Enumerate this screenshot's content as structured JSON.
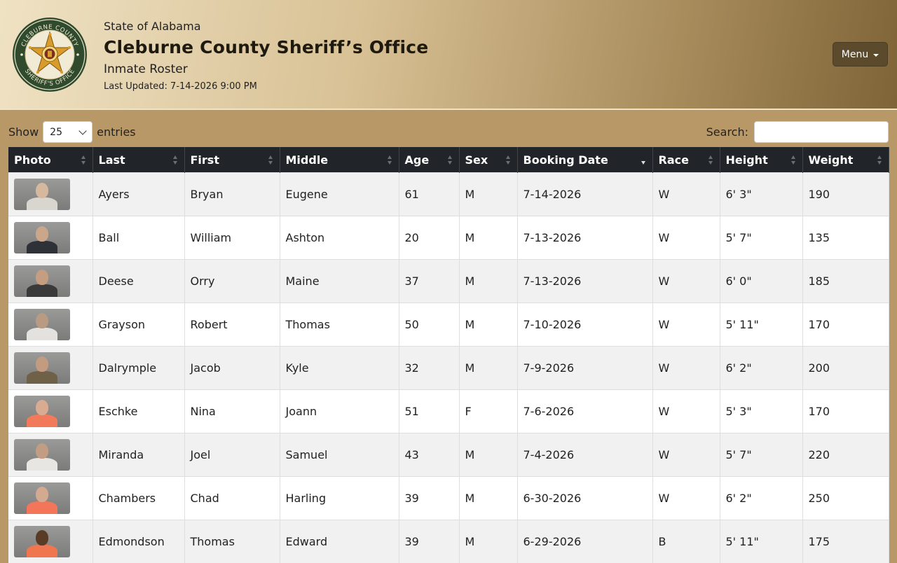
{
  "header": {
    "state": "State of Alabama",
    "office": "Cleburne County Sheriff’s Office",
    "subtitle": "Inmate Roster",
    "last_updated": "Last Updated: 7-14-2026 9:00 PM",
    "seal_text_top": "CLEBURNE COUNTY",
    "seal_text_bottom": "SHERIFF'S OFFICE",
    "menu_label": "Menu"
  },
  "controls": {
    "show_label": "Show",
    "entries_value": "25",
    "entries_label": "entries",
    "search_label": "Search:",
    "search_value": ""
  },
  "table": {
    "columns": [
      "Photo",
      "Last",
      "First",
      "Middle",
      "Age",
      "Sex",
      "Booking Date",
      "Race",
      "Height",
      "Weight"
    ],
    "sorted_column": "Booking Date",
    "rows": [
      {
        "last": "Ayers",
        "first": "Bryan",
        "middle": "Eugene",
        "age": "61",
        "sex": "M",
        "booking": "7-14-2026",
        "race": "W",
        "height": "6' 3\"",
        "weight": "190",
        "shirt": "#d8d6cf",
        "skin": "#d5b89e"
      },
      {
        "last": "Ball",
        "first": "William",
        "middle": "Ashton",
        "age": "20",
        "sex": "M",
        "booking": "7-13-2026",
        "race": "W",
        "height": "5' 7\"",
        "weight": "135",
        "shirt": "#2f3138",
        "skin": "#caa78a"
      },
      {
        "last": "Deese",
        "first": "Orry",
        "middle": "Maine",
        "age": "37",
        "sex": "M",
        "booking": "7-13-2026",
        "race": "W",
        "height": "6' 0\"",
        "weight": "185",
        "shirt": "#3a3a3a",
        "skin": "#c59d80"
      },
      {
        "last": "Grayson",
        "first": "Robert",
        "middle": "Thomas",
        "age": "50",
        "sex": "M",
        "booking": "7-10-2026",
        "race": "W",
        "height": "5' 11\"",
        "weight": "170",
        "shirt": "#e4e2de",
        "skin": "#b99a83"
      },
      {
        "last": "Dalrymple",
        "first": "Jacob",
        "middle": "Kyle",
        "age": "32",
        "sex": "M",
        "booking": "7-9-2026",
        "race": "W",
        "height": "6' 2\"",
        "weight": "200",
        "shirt": "#6f6048",
        "skin": "#c39b80"
      },
      {
        "last": "Eschke",
        "first": "Nina",
        "middle": "Joann",
        "age": "51",
        "sex": "F",
        "booking": "7-6-2026",
        "race": "W",
        "height": "5' 3\"",
        "weight": "170",
        "shirt": "#f07a5a",
        "skin": "#d8ab92"
      },
      {
        "last": "Miranda",
        "first": "Joel",
        "middle": "Samuel",
        "age": "43",
        "sex": "M",
        "booking": "7-4-2026",
        "race": "W",
        "height": "5' 7\"",
        "weight": "220",
        "shirt": "#e8e6e2",
        "skin": "#c29d84"
      },
      {
        "last": "Chambers",
        "first": "Chad",
        "middle": "Harling",
        "age": "39",
        "sex": "M",
        "booking": "6-30-2026",
        "race": "W",
        "height": "6' 2\"",
        "weight": "250",
        "shirt": "#f3755a",
        "skin": "#d3a98f"
      },
      {
        "last": "Edmondson",
        "first": "Thomas",
        "middle": "Edward",
        "age": "39",
        "sex": "M",
        "booking": "6-29-2026",
        "race": "B",
        "height": "5' 11\"",
        "weight": "175",
        "shirt": "#f0764f",
        "skin": "#5a3b26"
      }
    ]
  }
}
